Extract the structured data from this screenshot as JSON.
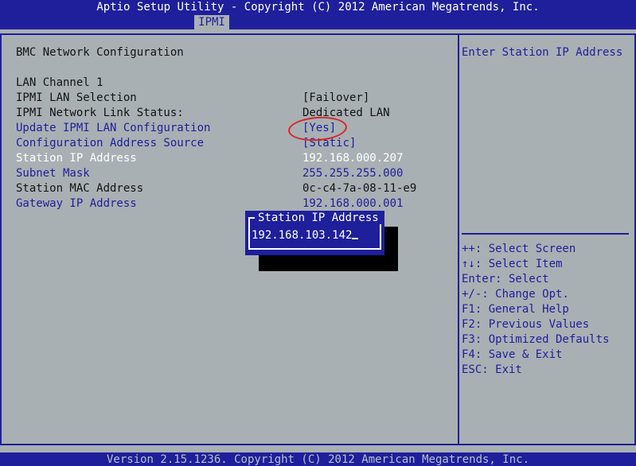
{
  "header": {
    "title": "Aptio Setup Utility - Copyright (C) 2012 American Megatrends, Inc.",
    "active_tab": "IPMI"
  },
  "footer": {
    "version": "Version 2.15.1236. Copyright (C) 2012 American Megatrends, Inc."
  },
  "main": {
    "section_title": "BMC Network Configuration",
    "lan_channel": "LAN Channel 1",
    "rows": [
      {
        "label": "IPMI LAN Selection",
        "value": "[Failover]",
        "editable": false
      },
      {
        "label": "IPMI Network Link Status:",
        "value": "Dedicated LAN",
        "editable": false
      },
      {
        "label": "Update IPMI LAN Configuration",
        "value": "[Yes]",
        "editable": true
      },
      {
        "label": "Configuration Address Source",
        "value": "[Static]",
        "editable": true
      },
      {
        "label": "Station IP Address",
        "value": "192.168.000.207",
        "editable": true
      },
      {
        "label": "Subnet Mask",
        "value": "255.255.255.000",
        "editable": true
      },
      {
        "label": "Station MAC Address",
        "value": "0c-c4-7a-08-11-e9",
        "editable": false
      },
      {
        "label": "Gateway IP Address",
        "value": "192.168.000.001",
        "editable": true
      }
    ]
  },
  "help": {
    "text": "Enter Station IP Address"
  },
  "keys": [
    "++: Select Screen",
    "↑↓: Select Item",
    "Enter: Select",
    "+/-: Change Opt.",
    "F1: General Help",
    "F2: Previous Values",
    "F3: Optimized Defaults",
    "F4: Save & Exit",
    "ESC: Exit"
  ],
  "popup": {
    "title": "Station IP Address",
    "value": "192.168.103.142"
  },
  "colors": {
    "bios_blue": "#1f1f9c",
    "background_gray": "#a9b0b3",
    "annotation_red": "#d8262a"
  }
}
